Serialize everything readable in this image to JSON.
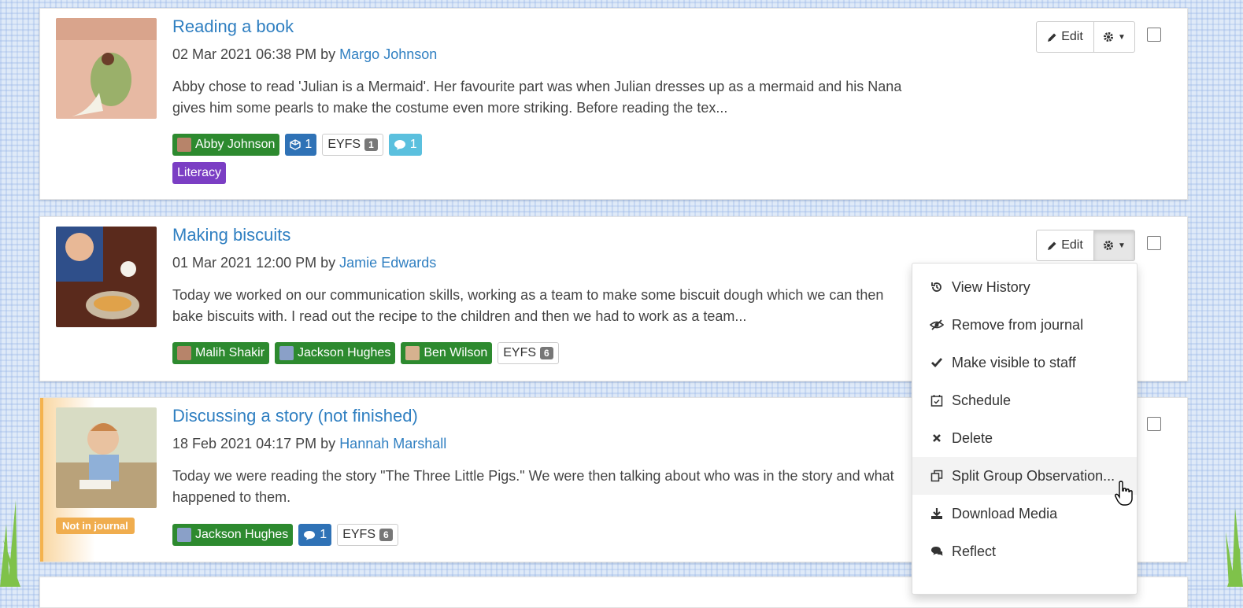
{
  "observations": [
    {
      "title": "Reading a book",
      "date": "02 Mar 2021 06:38 PM",
      "by": "by",
      "author": "Margo Johnson",
      "description": "Abby chose to read 'Julian is a Mermaid'. Her favourite part was when Julian dresses up as a mermaid and his Nana gives him some pearls to make the costume even more striking. Before reading the tex...",
      "children": [
        "Abby Johnson"
      ],
      "media_count": "1",
      "eyfs_label": "EYFS",
      "eyfs_count": "1",
      "comment_count": "1",
      "subject_tag": "Literacy"
    },
    {
      "title": "Making biscuits",
      "date": "01 Mar 2021 12:00 PM",
      "by": "by",
      "author": "Jamie Edwards",
      "description": "Today we worked on our communication skills, working as a team to make some biscuit dough which we can then bake biscuits with. I read out the recipe to the children and then we had to work as a team...",
      "children": [
        "Malih Shakir",
        "Jackson Hughes",
        "Ben Wilson"
      ],
      "eyfs_label": "EYFS",
      "eyfs_count": "6"
    },
    {
      "title": "Discussing a story (not finished)",
      "date": "18 Feb 2021 04:17 PM",
      "by": "by",
      "author": "Hannah Marshall",
      "description": "Today we were reading the story \"The Three Little Pigs.\" We were then talking about who was in the story and what happened to them.",
      "children": [
        "Jackson Hughes"
      ],
      "reflect_count": "1",
      "eyfs_label": "EYFS",
      "eyfs_count": "6",
      "status_badge": "Not in journal"
    }
  ],
  "buttons": {
    "edit": "Edit"
  },
  "dropdown_menu": [
    {
      "label": "View History",
      "icon": "history-icon"
    },
    {
      "label": "Remove from journal",
      "icon": "eye-slash-icon"
    },
    {
      "label": "Make visible to staff",
      "icon": "check-icon"
    },
    {
      "label": "Schedule",
      "icon": "calendar-check-icon"
    },
    {
      "label": "Delete",
      "icon": "times-icon"
    },
    {
      "label": "Split Group Observation...",
      "icon": "clone-icon"
    },
    {
      "label": "Download Media",
      "icon": "download-icon"
    },
    {
      "label": "Reflect",
      "icon": "comments-icon"
    }
  ],
  "colors": {
    "link": "#2f7fc1",
    "child_tag": "#2d8a2f",
    "media_tag": "#2f72b6",
    "comment_tag": "#5bc0de",
    "subject_tag": "#7b3ec4",
    "not_in_journal": "#f0ad4e"
  }
}
